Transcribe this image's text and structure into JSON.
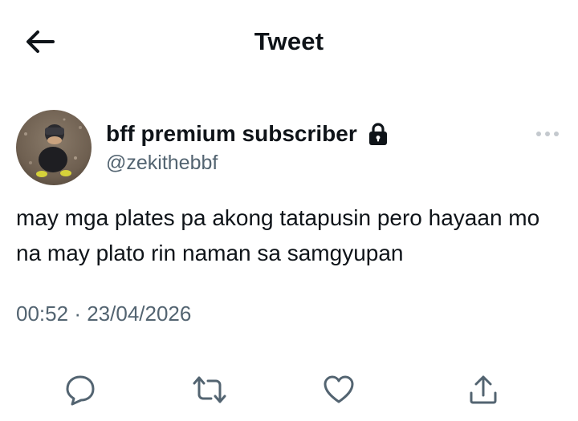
{
  "header": {
    "title": "Tweet",
    "back_icon": "arrow-left-icon"
  },
  "author": {
    "display_name": "bff premium subscriber",
    "handle": "@zekithebbf",
    "protected_icon": "lock-icon",
    "more_icon": "more-horizontal-icon"
  },
  "tweet": {
    "text": "may mga plates pa akong tatapusin pero hayaan mo na may plato rin naman sa samgyupan",
    "time": "00:52",
    "separator": "·",
    "date": "23/04/2026"
  },
  "actions": {
    "icons": [
      "reply-icon",
      "retweet-icon",
      "like-icon",
      "share-icon"
    ],
    "icon_color": "#536471"
  },
  "colors": {
    "text_primary": "#0f1419",
    "text_secondary": "#536471",
    "background": "#ffffff"
  }
}
